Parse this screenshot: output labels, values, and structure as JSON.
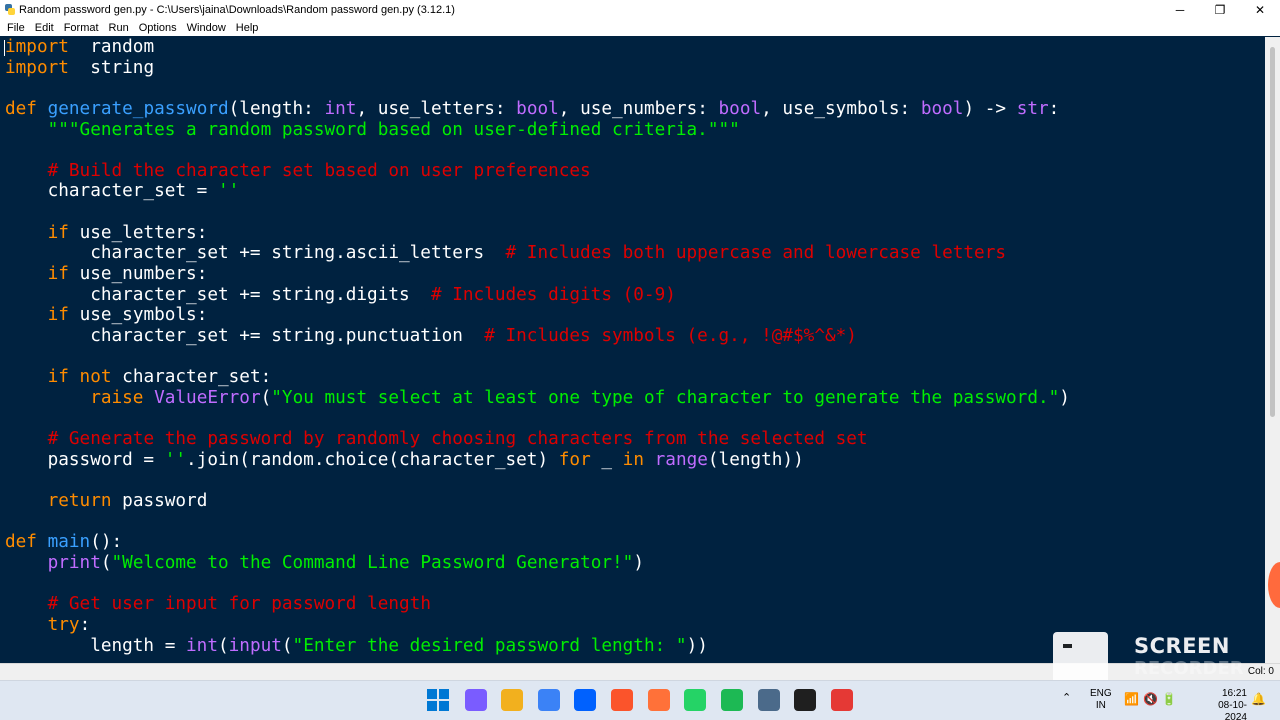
{
  "window": {
    "title": "Random password gen.py - C:\\Users\\jaina\\Downloads\\Random password gen.py (3.12.1)",
    "minimize": "─",
    "maximize": "❐",
    "close": "✕"
  },
  "menu": [
    "File",
    "Edit",
    "Format",
    "Run",
    "Options",
    "Window",
    "Help"
  ],
  "status": {
    "position": "Col: 0"
  },
  "watermark": {
    "line1": "SCREEN",
    "line2": "RECORDER"
  },
  "tray": {
    "chevron": "⌃",
    "lang1": "ENG",
    "lang2": "IN",
    "icons": "📶🔇🔋",
    "time": "16:21",
    "date": "08-10-2024",
    "bell": "🔔"
  },
  "taskbar": {
    "icons": [
      "windows-start-icon",
      "copilot-icon",
      "file-explorer-icon",
      "microsoft-store-icon",
      "dropbox-icon",
      "brave-icon",
      "firefox-icon",
      "whatsapp-icon",
      "spotify-icon",
      "python-idle-icon",
      "terminal-icon",
      "screen-recorder-icon"
    ],
    "colors": [
      "#0078d4",
      "#7a5cff",
      "#f2b01e",
      "#3b82f6",
      "#0061fe",
      "#fb542b",
      "#ff7139",
      "#25d366",
      "#1db954",
      "#4b6a8a",
      "#1f1f1f",
      "#e53935"
    ]
  },
  "code": [
    [
      [
        "kw",
        "import"
      ],
      [
        "",
        "  random"
      ]
    ],
    [
      [
        "kw",
        "import"
      ],
      [
        "",
        "  string"
      ]
    ],
    [],
    [
      [
        "kw",
        "def"
      ],
      [
        "",
        " "
      ],
      [
        "df",
        "generate_password"
      ],
      [
        "",
        "(length: "
      ],
      [
        "bi",
        "int"
      ],
      [
        "",
        ", use_letters: "
      ],
      [
        "bi",
        "bool"
      ],
      [
        "",
        ", use_numbers: "
      ],
      [
        "bi",
        "bool"
      ],
      [
        "",
        ", use_symbols: "
      ],
      [
        "bi",
        "bool"
      ],
      [
        "",
        ") -> "
      ],
      [
        "bi",
        "str"
      ],
      [
        "",
        ":"
      ]
    ],
    [
      [
        "",
        "    "
      ],
      [
        "st",
        "\"\"\"Generates a random password based on user-defined criteria.\"\"\""
      ]
    ],
    [],
    [
      [
        "",
        "    "
      ],
      [
        "cm",
        "# Build the character set based on user preferences"
      ]
    ],
    [
      [
        "",
        "    character_set = "
      ],
      [
        "st",
        "''"
      ]
    ],
    [],
    [
      [
        "",
        "    "
      ],
      [
        "kw",
        "if"
      ],
      [
        "",
        " use_letters:"
      ]
    ],
    [
      [
        "",
        "        character_set += string.ascii_letters  "
      ],
      [
        "cm",
        "# Includes both uppercase and lowercase letters"
      ]
    ],
    [
      [
        "",
        "    "
      ],
      [
        "kw",
        "if"
      ],
      [
        "",
        " use_numbers:"
      ]
    ],
    [
      [
        "",
        "        character_set += string.digits  "
      ],
      [
        "cm",
        "# Includes digits (0-9)"
      ]
    ],
    [
      [
        "",
        "    "
      ],
      [
        "kw",
        "if"
      ],
      [
        "",
        " use_symbols:"
      ]
    ],
    [
      [
        "",
        "        character_set += string.punctuation  "
      ],
      [
        "cm",
        "# Includes symbols (e.g., !@#$%^&*)"
      ]
    ],
    [],
    [
      [
        "",
        "    "
      ],
      [
        "kw",
        "if not"
      ],
      [
        "",
        " character_set:"
      ]
    ],
    [
      [
        "",
        "        "
      ],
      [
        "kw",
        "raise"
      ],
      [
        "",
        " "
      ],
      [
        "bi",
        "ValueError"
      ],
      [
        "",
        "("
      ],
      [
        "st",
        "\"You must select at least one type of character to generate the password.\""
      ],
      [
        "",
        ")"
      ]
    ],
    [],
    [
      [
        "",
        "    "
      ],
      [
        "cm",
        "# Generate the password by randomly choosing characters from the selected set"
      ]
    ],
    [
      [
        "",
        "    password = "
      ],
      [
        "st",
        "''"
      ],
      [
        "",
        ".join(random.choice(character_set) "
      ],
      [
        "kw",
        "for"
      ],
      [
        "",
        " _ "
      ],
      [
        "kw",
        "in"
      ],
      [
        "",
        " "
      ],
      [
        "bi",
        "range"
      ],
      [
        "",
        "(length))"
      ]
    ],
    [],
    [
      [
        "",
        "    "
      ],
      [
        "kw",
        "return"
      ],
      [
        "",
        " password"
      ]
    ],
    [],
    [
      [
        "kw",
        "def"
      ],
      [
        "",
        " "
      ],
      [
        "df",
        "main"
      ],
      [
        "",
        "():"
      ]
    ],
    [
      [
        "",
        "    "
      ],
      [
        "bi",
        "print"
      ],
      [
        "",
        "("
      ],
      [
        "st",
        "\"Welcome to the Command Line Password Generator!\""
      ],
      [
        "",
        ")"
      ]
    ],
    [],
    [
      [
        "",
        "    "
      ],
      [
        "cm",
        "# Get user input for password length"
      ]
    ],
    [
      [
        "",
        "    "
      ],
      [
        "kw",
        "try"
      ],
      [
        "",
        ":"
      ]
    ],
    [
      [
        "",
        "        length = "
      ],
      [
        "bi",
        "int"
      ],
      [
        "",
        "("
      ],
      [
        "bi",
        "input"
      ],
      [
        "",
        "("
      ],
      [
        "st",
        "\"Enter the desired password length: \""
      ],
      [
        "",
        "))"
      ]
    ]
  ]
}
